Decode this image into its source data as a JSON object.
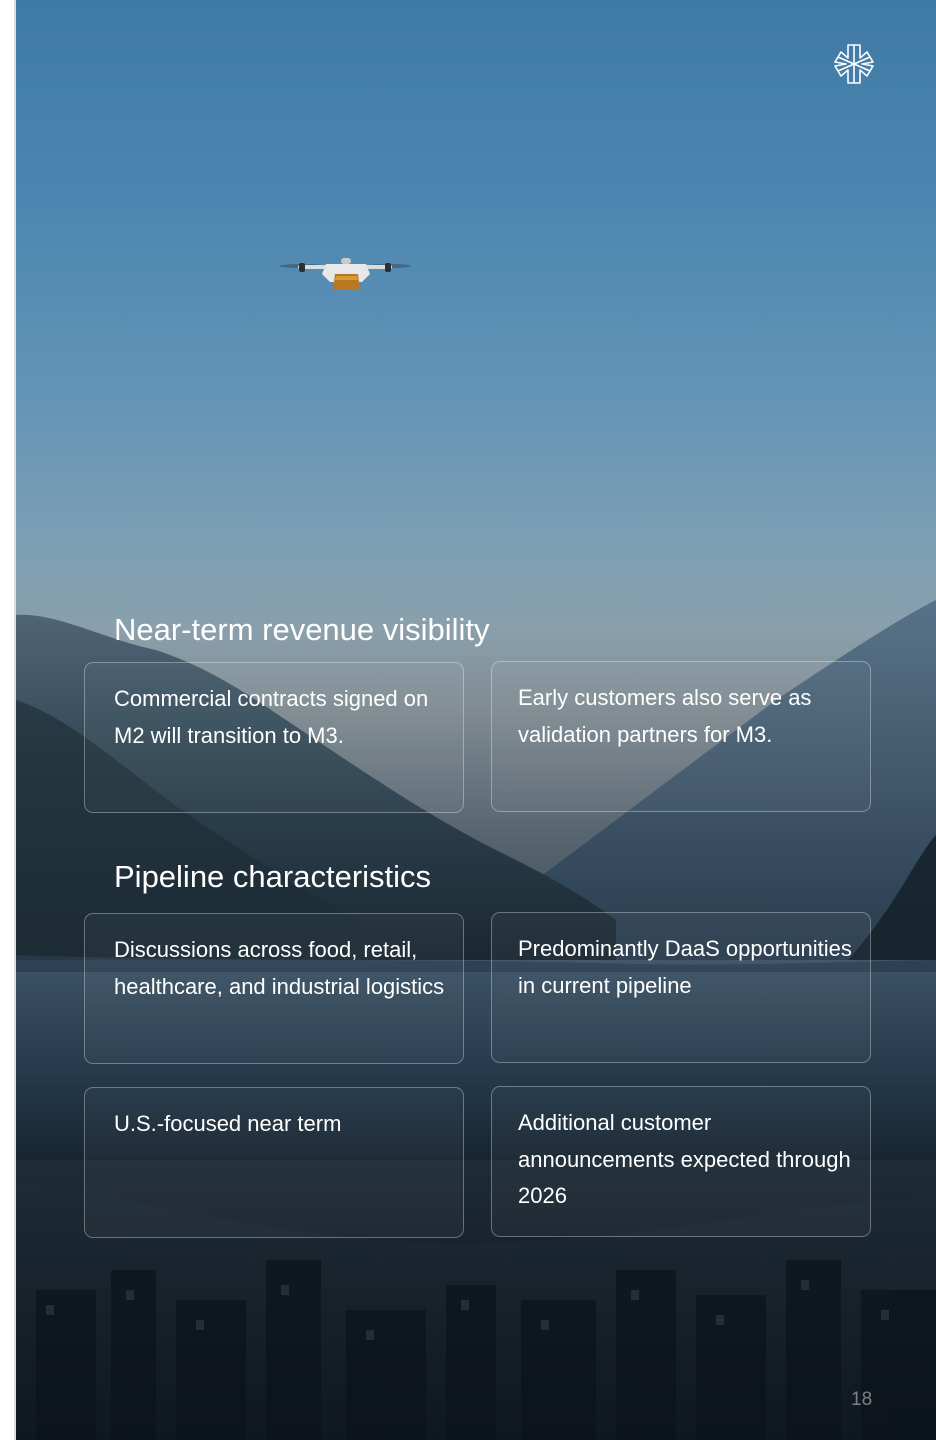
{
  "slide": {
    "sections": [
      {
        "title": "Near-term revenue visibility",
        "cards": [
          "Commercial contracts signed on M2 will transition to M3.",
          "Early customers also serve as validation partners for M3."
        ]
      },
      {
        "title": "Pipeline characteristics",
        "cards": [
          "Discussions across food, retail, healthcare, and industrial logistics",
          "Predominantly DaaS opportunities in current pipeline",
          "U.S.-focused near term",
          "Additional customer announcements expected through 2026"
        ]
      }
    ],
    "page_number": "18"
  },
  "icons": {
    "logo": "snowflake-logo-icon"
  },
  "colors": {
    "text": "#ffffff",
    "card_border": "rgba(255,255,255,0.32)"
  }
}
